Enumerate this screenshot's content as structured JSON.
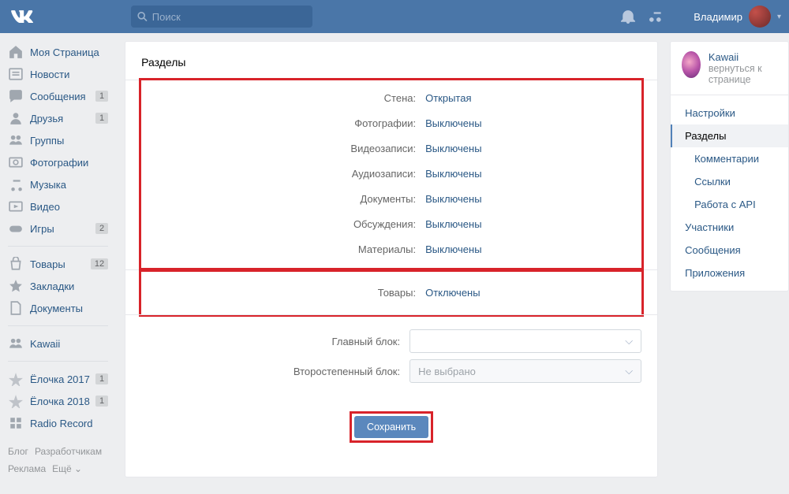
{
  "header": {
    "search_placeholder": "Поиск",
    "user_name": "Владимир"
  },
  "left_nav": {
    "items": [
      {
        "icon": "home",
        "label": "Моя Страница"
      },
      {
        "icon": "news",
        "label": "Новости"
      },
      {
        "icon": "msg",
        "label": "Сообщения",
        "badge": "1"
      },
      {
        "icon": "friends",
        "label": "Друзья",
        "badge": "1"
      },
      {
        "icon": "groups",
        "label": "Группы"
      },
      {
        "icon": "photo",
        "label": "Фотографии"
      },
      {
        "icon": "music",
        "label": "Музыка"
      },
      {
        "icon": "video",
        "label": "Видео"
      },
      {
        "icon": "games",
        "label": "Игры",
        "badge": "2"
      }
    ],
    "items2": [
      {
        "icon": "market",
        "label": "Товары",
        "badge": "12"
      },
      {
        "icon": "star",
        "label": "Закладки"
      },
      {
        "icon": "docs",
        "label": "Документы"
      }
    ],
    "items3": [
      {
        "icon": "groups",
        "label": "Kawaii"
      }
    ],
    "items4": [
      {
        "icon": "app",
        "label": "Ёлочка 2017",
        "badge": "1"
      },
      {
        "icon": "app",
        "label": "Ёлочка 2018",
        "badge": "1"
      },
      {
        "icon": "app2",
        "label": "Radio Record"
      }
    ],
    "footer": {
      "blog": "Блог",
      "dev": "Разработчикам",
      "ads": "Реклама",
      "more": "Ещё"
    }
  },
  "main": {
    "title": "Разделы",
    "settings": [
      {
        "label": "Стена:",
        "value": "Открытая"
      },
      {
        "label": "Фотографии:",
        "value": "Выключены"
      },
      {
        "label": "Видеозаписи:",
        "value": "Выключены"
      },
      {
        "label": "Аудиозаписи:",
        "value": "Выключены"
      },
      {
        "label": "Документы:",
        "value": "Выключены"
      },
      {
        "label": "Обсуждения:",
        "value": "Выключены"
      },
      {
        "label": "Материалы:",
        "value": "Выключены"
      }
    ],
    "market": {
      "label": "Товары:",
      "value": "Отключены"
    },
    "blocks": {
      "primary_label": "Главный блок:",
      "secondary_label": "Второстепенный блок:",
      "not_selected": "Не выбрано"
    },
    "save": "Сохранить"
  },
  "right": {
    "group_name": "Kawaii",
    "back": "вернуться к странице",
    "menu": [
      {
        "label": "Настройки",
        "active": false,
        "sub": false
      },
      {
        "label": "Разделы",
        "active": true,
        "sub": false
      },
      {
        "label": "Комментарии",
        "active": false,
        "sub": true
      },
      {
        "label": "Ссылки",
        "active": false,
        "sub": true
      },
      {
        "label": "Работа с API",
        "active": false,
        "sub": true
      },
      {
        "label": "Участники",
        "active": false,
        "sub": false
      },
      {
        "label": "Сообщения",
        "active": false,
        "sub": false
      },
      {
        "label": "Приложения",
        "active": false,
        "sub": false
      }
    ]
  }
}
